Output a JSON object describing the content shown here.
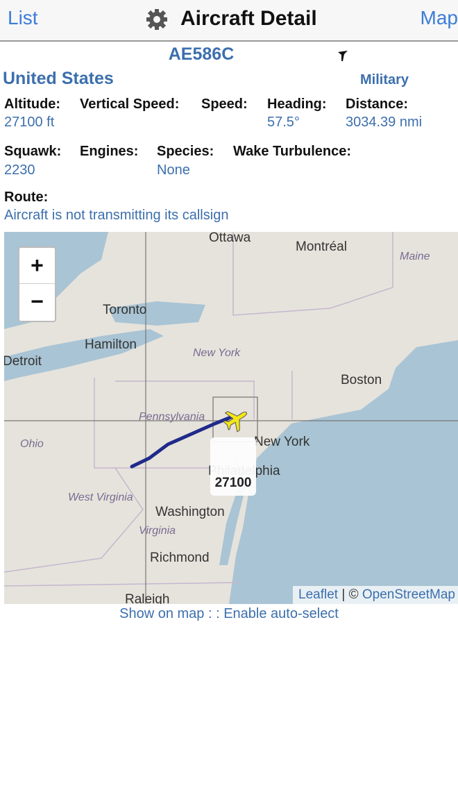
{
  "header": {
    "back_label": "List",
    "title": "Aircraft Detail",
    "map_label": "Map",
    "settings_icon": "gear-icon"
  },
  "aircraft": {
    "hex": "AE586C",
    "country": "United States",
    "category": "Military",
    "silhouette_icon": "aircraft-silhouette-icon"
  },
  "fields_row1": [
    {
      "label": "Altitude:",
      "value": "27100 ft"
    },
    {
      "label": "Vertical Speed:",
      "value": ""
    },
    {
      "label": "Speed:",
      "value": ""
    },
    {
      "label": "Heading:",
      "value": "57.5°"
    },
    {
      "label": "Distance:",
      "value": "3034.39 nmi"
    }
  ],
  "fields_row2": [
    {
      "label": "Squawk:",
      "value": "2230"
    },
    {
      "label": "Engines:",
      "value": ""
    },
    {
      "label": "Species:",
      "value": "None"
    },
    {
      "label": "Wake Turbulence:",
      "value": ""
    }
  ],
  "route": {
    "label": "Route:",
    "value": "Aircraft is not transmitting its callsign"
  },
  "map": {
    "zoom_in": "+",
    "zoom_out": "−",
    "cities": [
      "Ottawa",
      "Montréal",
      "Toronto",
      "Hamilton",
      "Detroit",
      "Boston",
      "New York",
      "Philadelphia",
      "Washington",
      "Richmond",
      "Raleigh"
    ],
    "states": [
      "Maine",
      "New York",
      "Pennsylvania",
      "Ohio",
      "West Virginia",
      "Virginia"
    ],
    "aircraft_label": "27100",
    "track_color": "#1f2a8a",
    "aircraft_color": "#f5e616",
    "attribution_leaflet": "Leaflet",
    "attribution_sep": " | © ",
    "attribution_osm": "OpenStreetMap"
  },
  "footer": {
    "show_on_map": "Show on map",
    "sep": " : : ",
    "auto_select": "Enable auto-select"
  }
}
